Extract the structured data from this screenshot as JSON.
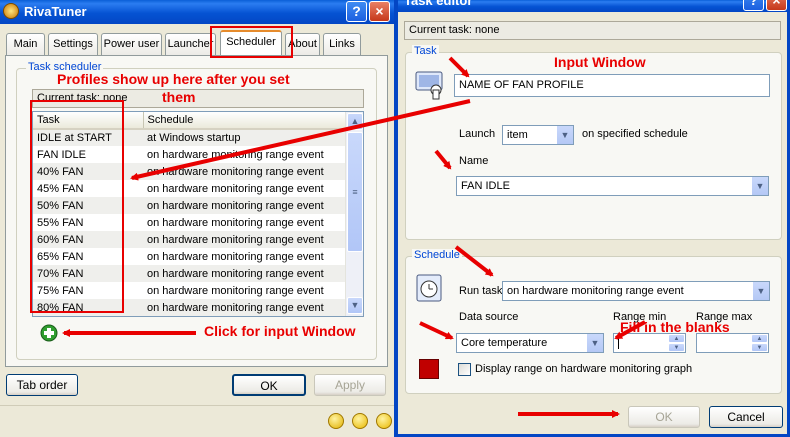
{
  "rivatuner": {
    "title": "RivaTuner",
    "help_icon": "?",
    "close_icon": "×",
    "tabs": [
      "Main",
      "Settings",
      "Power user",
      "Launcher",
      "Scheduler",
      "About",
      "Links"
    ],
    "group_label": "Task scheduler",
    "current_task": "Current task: none",
    "columns": [
      "Task",
      "Schedule"
    ],
    "rows": [
      [
        "IDLE at START",
        "at Windows startup"
      ],
      [
        "FAN IDLE",
        "on hardware monitoring range event"
      ],
      [
        "40% FAN",
        "on hardware monitoring range event"
      ],
      [
        "45% FAN",
        "on hardware monitoring range event"
      ],
      [
        "50% FAN",
        "on hardware monitoring range event"
      ],
      [
        "55% FAN",
        "on hardware monitoring range event"
      ],
      [
        "60% FAN",
        "on hardware monitoring range event"
      ],
      [
        "65% FAN",
        "on hardware monitoring range event"
      ],
      [
        "70% FAN",
        "on hardware monitoring range event"
      ],
      [
        "75% FAN",
        "on hardware monitoring range event"
      ],
      [
        "80% FAN",
        "on hardware monitoring range event"
      ]
    ],
    "buttons": {
      "tab_order": "Tab order",
      "ok": "OK",
      "apply": "Apply"
    }
  },
  "task_editor": {
    "title": "Task editor",
    "current_task": "Current task: none",
    "task_group_label": "Task",
    "task_name_value": "NAME OF FAN PROFILE",
    "launch_label": "Launch",
    "launch_value": "item",
    "launch_suffix": "on specified schedule",
    "name_label": "Name",
    "name_value": "FAN IDLE",
    "schedule_group_label": "Schedule",
    "run_task_label": "Run task",
    "run_task_value": "on hardware monitoring range event",
    "data_source_label": "Data source",
    "data_source_value": "Core temperature",
    "range_min_label": "Range min",
    "range_max_label": "Range max",
    "display_range_label": "Display range on hardware monitoring graph",
    "buttons": {
      "ok": "OK",
      "cancel": "Cancel"
    }
  },
  "annotations": {
    "profiles": "Profiles show up here after you set",
    "profiles_line2": "them",
    "click_input": "Click for input Window",
    "input_window": "Input Window",
    "fill_blanks": "Fill in the blanks"
  },
  "colors": {
    "annotation": "#e80000",
    "accent": "#0046d5",
    "swatch": "#c00000"
  }
}
